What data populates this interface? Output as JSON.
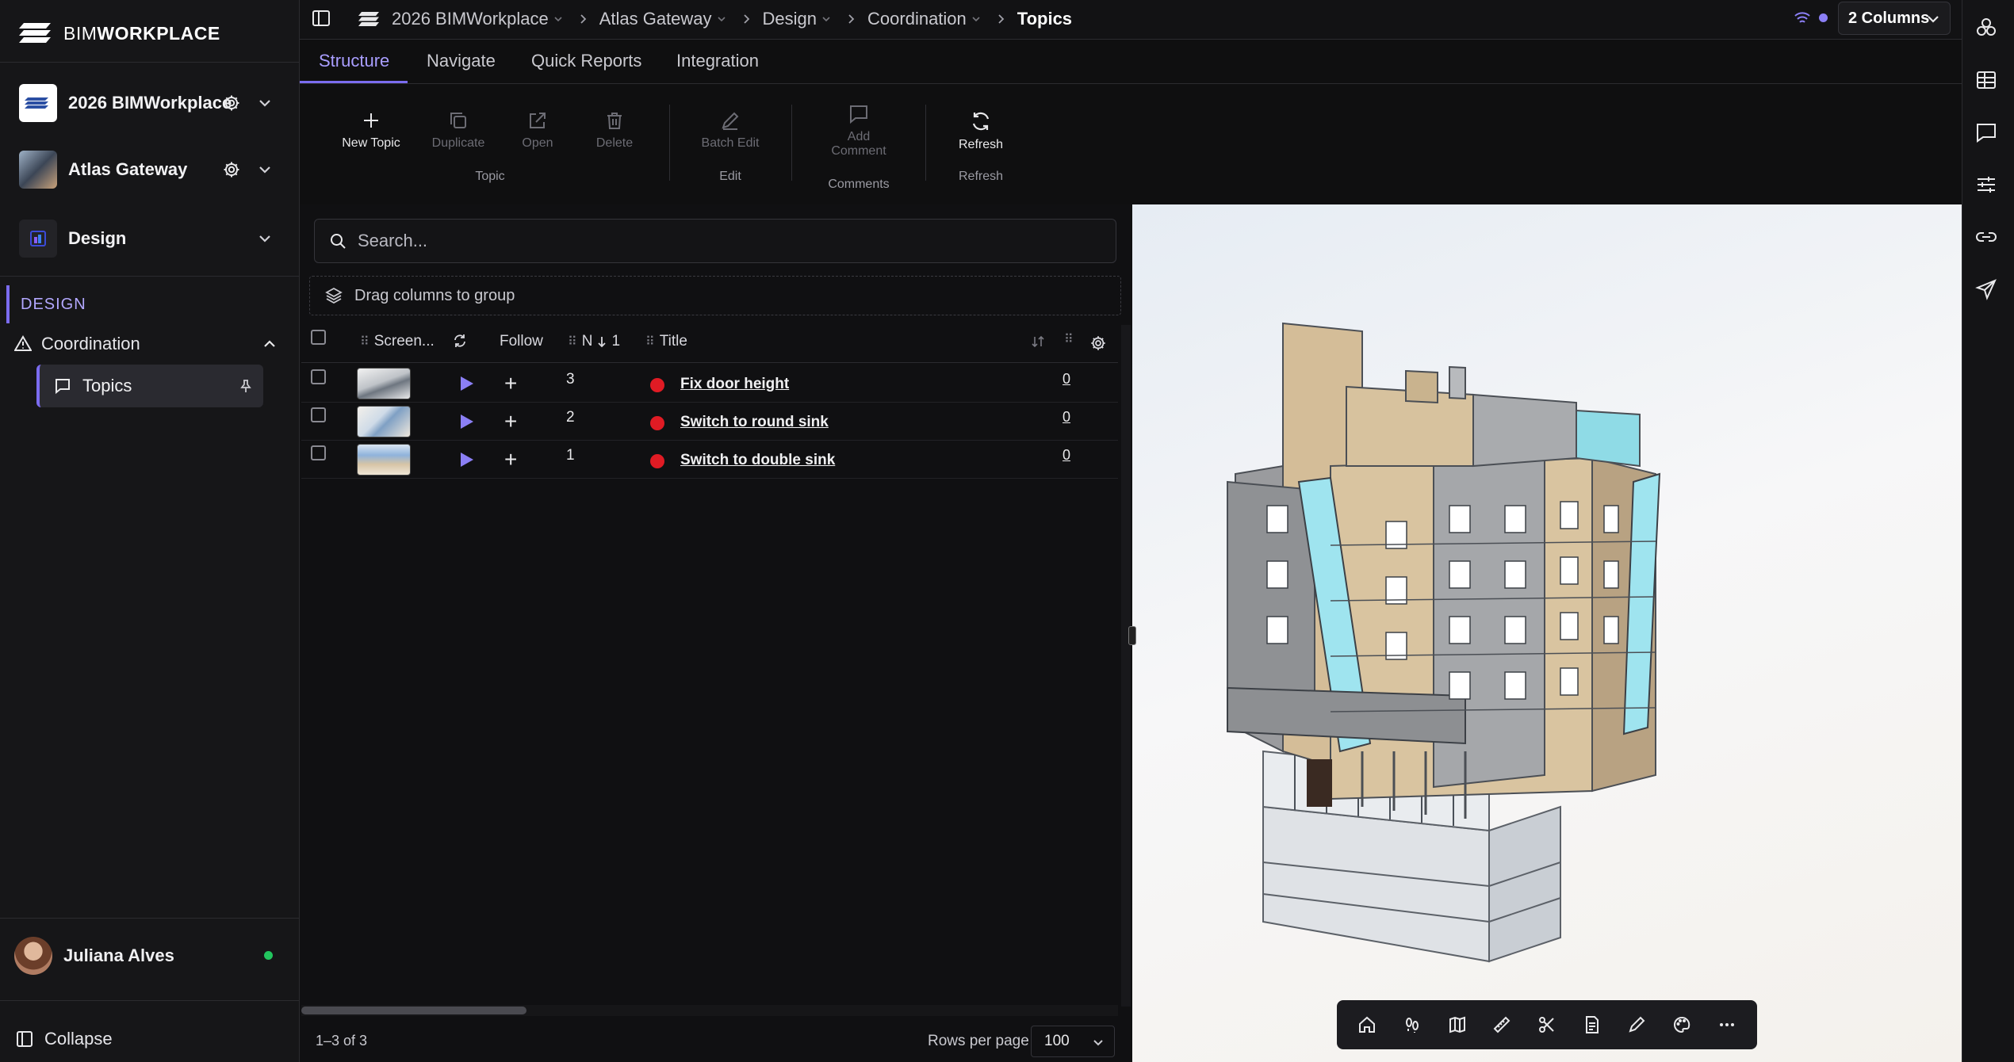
{
  "brand": {
    "light": "BIM",
    "bold": "WORKPLACE"
  },
  "sidebar": {
    "workspace": "2026 BIMWorkplace",
    "project": "Atlas Gateway",
    "module": "Design",
    "section_label": "DESIGN",
    "group_label": "Coordination",
    "active_item": "Topics",
    "user_name": "Juliana Alves",
    "collapse_label": "Collapse"
  },
  "breadcrumb": [
    "2026 BIMWorkplace",
    "Atlas Gateway",
    "Design",
    "Coordination",
    "Topics"
  ],
  "header": {
    "columns_label": "2 Columns"
  },
  "tabs": [
    "Structure",
    "Navigate",
    "Quick Reports",
    "Integration"
  ],
  "ribbon": {
    "new_topic": "New Topic",
    "duplicate": "Duplicate",
    "open": "Open",
    "delete": "Delete",
    "group_topic": "Topic",
    "batch_edit": "Batch Edit",
    "group_edit": "Edit",
    "add_comment_1": "Add",
    "add_comment_2": "Comment",
    "group_comments": "Comments",
    "refresh": "Refresh",
    "group_refresh": "Refresh"
  },
  "grid": {
    "search_placeholder": "Search...",
    "group_hint": "Drag columns to group",
    "columns": {
      "screenshot": "Screen...",
      "follow": "Follow",
      "number": "N",
      "sort_rank": "1",
      "title": "Title"
    },
    "rows": [
      {
        "number": "3",
        "title": "Fix door height",
        "comments": "0"
      },
      {
        "number": "2",
        "title": "Switch to round sink",
        "comments": "0"
      },
      {
        "number": "1",
        "title": "Switch to double sink",
        "comments": "0"
      }
    ],
    "footer": {
      "count": "1–3 of 3",
      "rows_per_page_label": "Rows per page",
      "rows_per_page": "100"
    }
  },
  "colors": {
    "accent": "#7b6cf0",
    "priority_high": "#e01b24",
    "online": "#22c55e"
  },
  "icons": [
    "logo-icon",
    "gear-icon",
    "chevron-down-icon",
    "warning-triangle-icon",
    "chat-bubble-icon",
    "pin-icon",
    "collapse-icon",
    "panel-toggle-icon",
    "wifi-icon",
    "plus-icon",
    "duplicate-icon",
    "open-external-icon",
    "trash-icon",
    "pencil-icon",
    "refresh-icon",
    "search-icon",
    "layers-icon",
    "bcf-icon",
    "table-icon",
    "sliders-icon",
    "link-icon",
    "send-icon",
    "home-icon",
    "walk-icon",
    "map-icon",
    "ruler-icon",
    "scissors-icon",
    "document-icon",
    "pen-icon",
    "palette-icon",
    "more-icon"
  ]
}
